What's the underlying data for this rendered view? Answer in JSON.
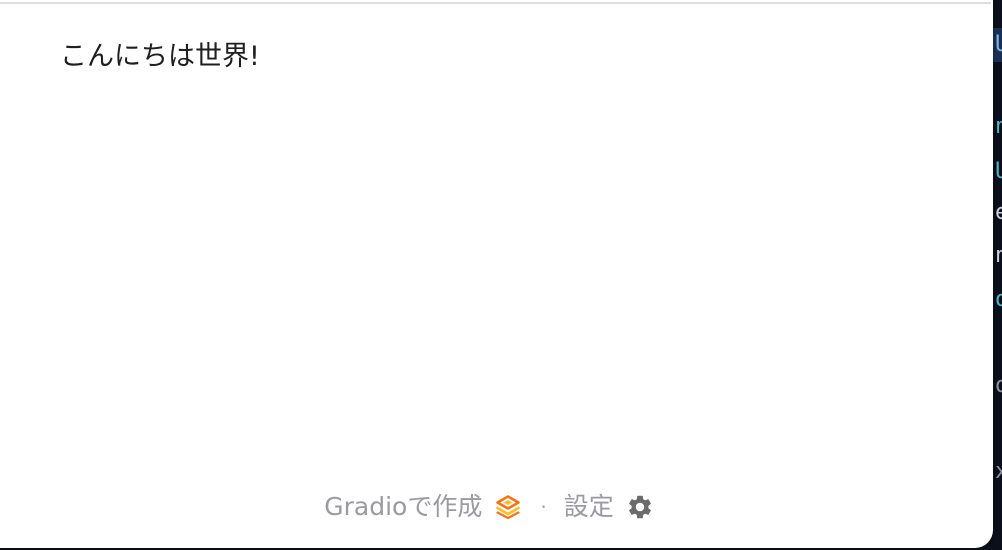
{
  "app": {
    "greeting": "こんにちは世界!"
  },
  "footer": {
    "built_with_label": "Gradioで作成",
    "separator": "·",
    "settings_label": "設定",
    "icons": {
      "logo": "gradio-logo-icon",
      "settings": "gear-icon"
    }
  },
  "background": {
    "glyph_fragments": [
      "U",
      "n",
      "U",
      "e",
      "n",
      "o",
      "o",
      "x"
    ]
  },
  "colors": {
    "page_background": "#0b0f19",
    "panel_background": "#ffffff",
    "greeting_text": "#1f1f1f",
    "footer_text": "#9a9aa2",
    "logo_orange": "#f97316",
    "logo_yellow": "#fbbf24",
    "gear": "#6b6b6b"
  }
}
